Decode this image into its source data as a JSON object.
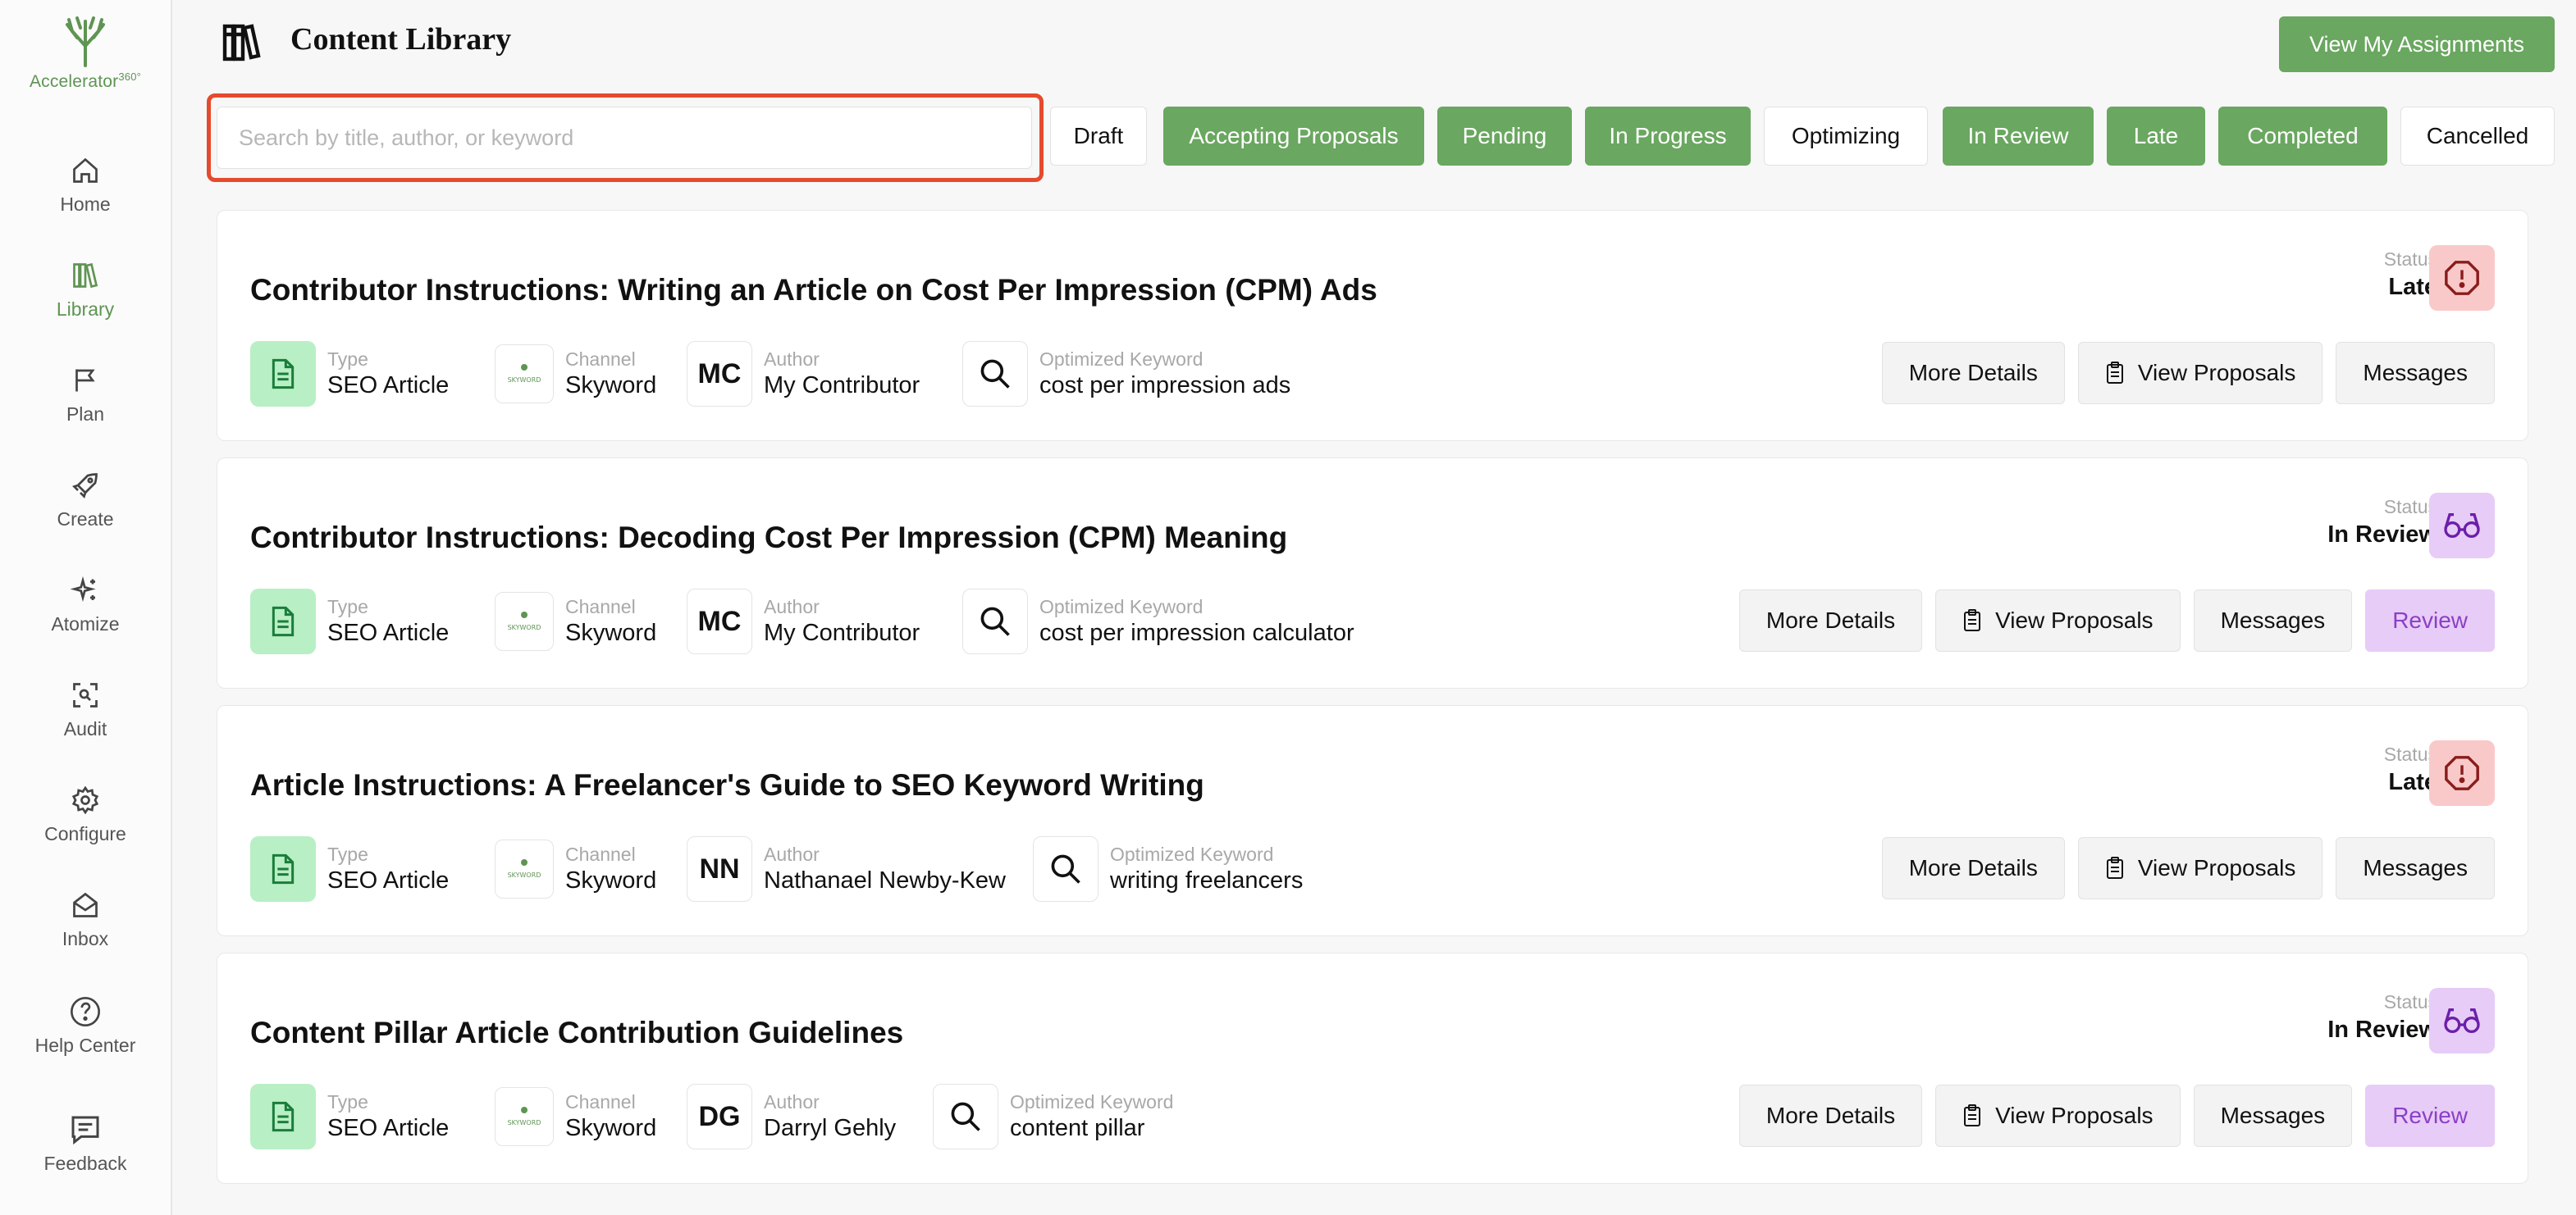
{
  "app": {
    "brand": "Accelerator",
    "brand_suffix": "360°",
    "page_title": "Content Library"
  },
  "header": {
    "assignments_label": "View My Assignments"
  },
  "search": {
    "placeholder": "Search by title, author, or keyword",
    "value": ""
  },
  "sidebar": {
    "items": [
      {
        "label": "Home",
        "icon": "home-icon",
        "active": false
      },
      {
        "label": "Library",
        "icon": "library-icon",
        "active": true
      },
      {
        "label": "Plan",
        "icon": "flag-icon",
        "active": false
      },
      {
        "label": "Create",
        "icon": "rocket-icon",
        "active": false
      },
      {
        "label": "Atomize",
        "icon": "sparkle-icon",
        "active": false
      },
      {
        "label": "Audit",
        "icon": "scan-icon",
        "active": false
      },
      {
        "label": "Configure",
        "icon": "gear-icon",
        "active": false
      },
      {
        "label": "Inbox",
        "icon": "envelope-icon",
        "active": false
      },
      {
        "label": "Help Center",
        "icon": "help-icon",
        "active": false
      },
      {
        "label": "Feedback",
        "icon": "feedback-icon",
        "active": false
      }
    ]
  },
  "filters": [
    {
      "label": "Draft",
      "selected": false
    },
    {
      "label": "Accepting Proposals",
      "selected": true
    },
    {
      "label": "Pending",
      "selected": true
    },
    {
      "label": "In Progress",
      "selected": true
    },
    {
      "label": "Optimizing",
      "selected": false
    },
    {
      "label": "In Review",
      "selected": true
    },
    {
      "label": "Late",
      "selected": true
    },
    {
      "label": "Completed",
      "selected": true
    },
    {
      "label": "Cancelled",
      "selected": false
    }
  ],
  "labels": {
    "type": "Type",
    "channel": "Channel",
    "author": "Author",
    "keyword": "Optimized Keyword",
    "status": "Status",
    "more_details": "More Details",
    "view_proposals": "View Proposals",
    "messages": "Messages",
    "review": "Review",
    "channel_logo_text": "SKYWORD"
  },
  "colors": {
    "accent": "#6aa760",
    "late": "#f9c9c9",
    "review": "#e7ccf7",
    "highlight": "#e64a2e"
  },
  "items": [
    {
      "title": "Contributor Instructions: Writing an Article on Cost Per Impression (CPM) Ads",
      "type": "SEO Article",
      "channel": "Skyword",
      "author_initials": "MC",
      "author": "My Contributor",
      "keyword": "cost per impression ads",
      "status": "Late",
      "has_review": false
    },
    {
      "title": "Contributor Instructions: Decoding Cost Per Impression (CPM) Meaning",
      "type": "SEO Article",
      "channel": "Skyword",
      "author_initials": "MC",
      "author": "My Contributor",
      "keyword": "cost per impression calculator",
      "status": "In Review",
      "has_review": true
    },
    {
      "title": "Article Instructions: A Freelancer's Guide to SEO Keyword Writing",
      "type": "SEO Article",
      "channel": "Skyword",
      "author_initials": "NN",
      "author": "Nathanael Newby-Kew",
      "keyword": "writing freelancers",
      "status": "Late",
      "has_review": false
    },
    {
      "title": "Content Pillar Article Contribution Guidelines",
      "type": "SEO Article",
      "channel": "Skyword",
      "author_initials": "DG",
      "author": "Darryl Gehly",
      "keyword": "content pillar",
      "status": "In Review",
      "has_review": true
    }
  ]
}
